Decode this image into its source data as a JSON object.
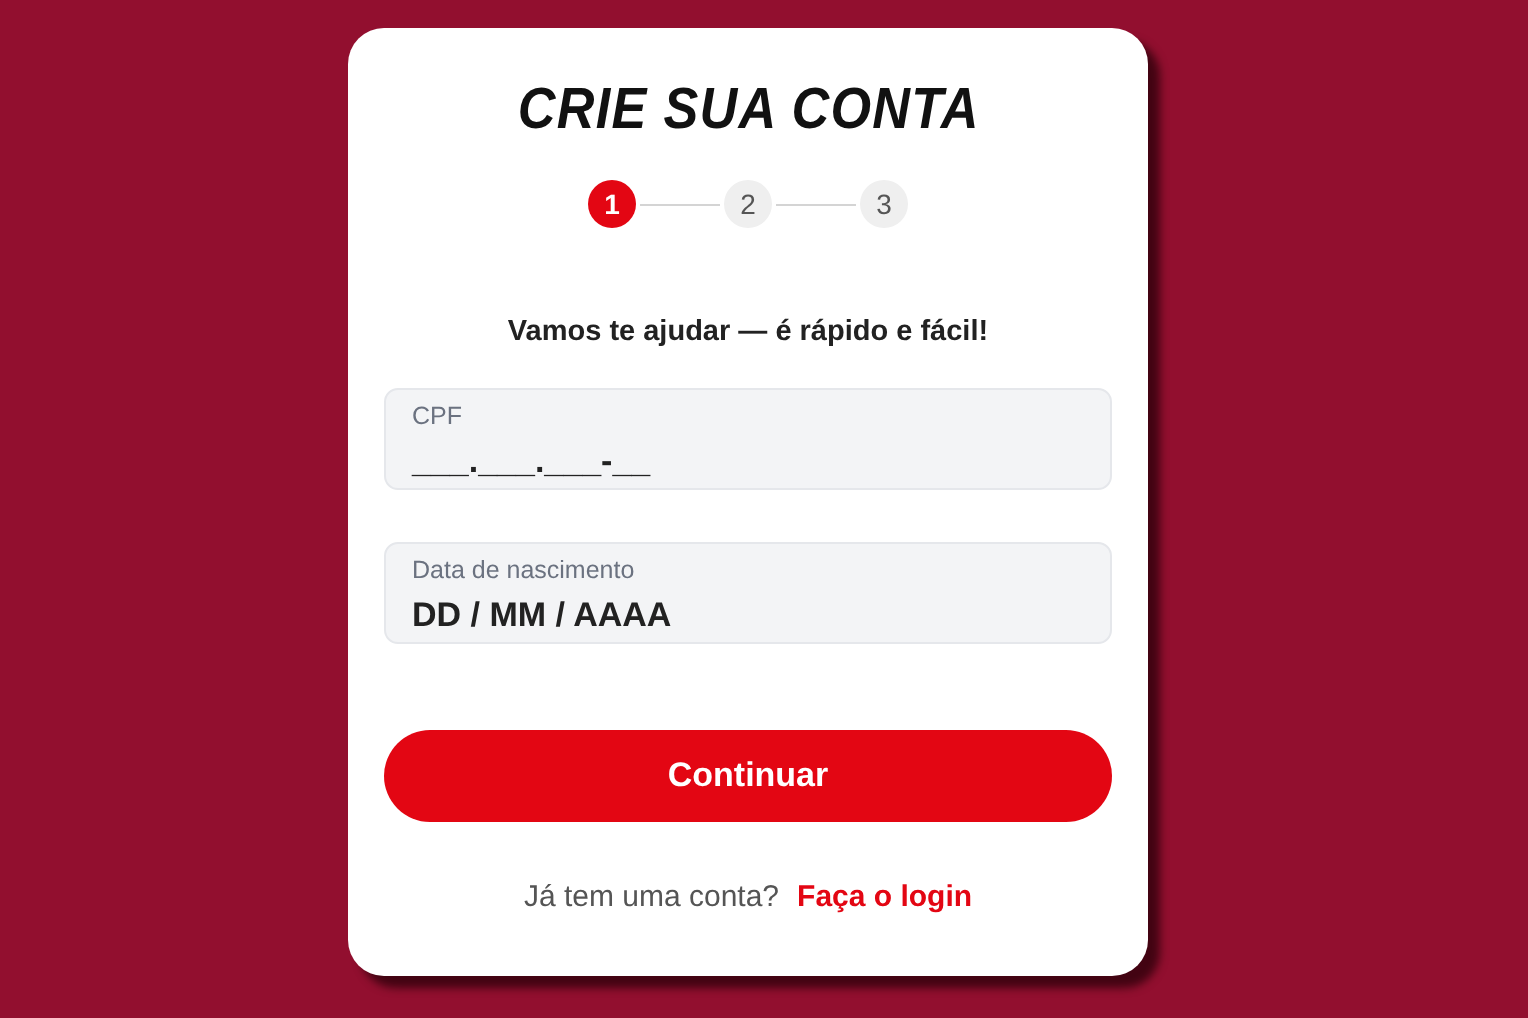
{
  "title": "CRIE SUA CONTA",
  "steps": [
    {
      "label": "1",
      "selected": true
    },
    {
      "label": "2",
      "selected": false
    },
    {
      "label": "3",
      "selected": false
    }
  ],
  "subtitle": "Vamos te ajudar — é rápido e fácil!",
  "fields": [
    {
      "label": "CPF",
      "value": "___.___.___-__"
    },
    {
      "label": "Data de nascimento",
      "value": "DD / MM / AAAA"
    }
  ],
  "button": "Continuar",
  "footer": {
    "text": "Já tem uma conta?",
    "link": "Faça o login"
  }
}
